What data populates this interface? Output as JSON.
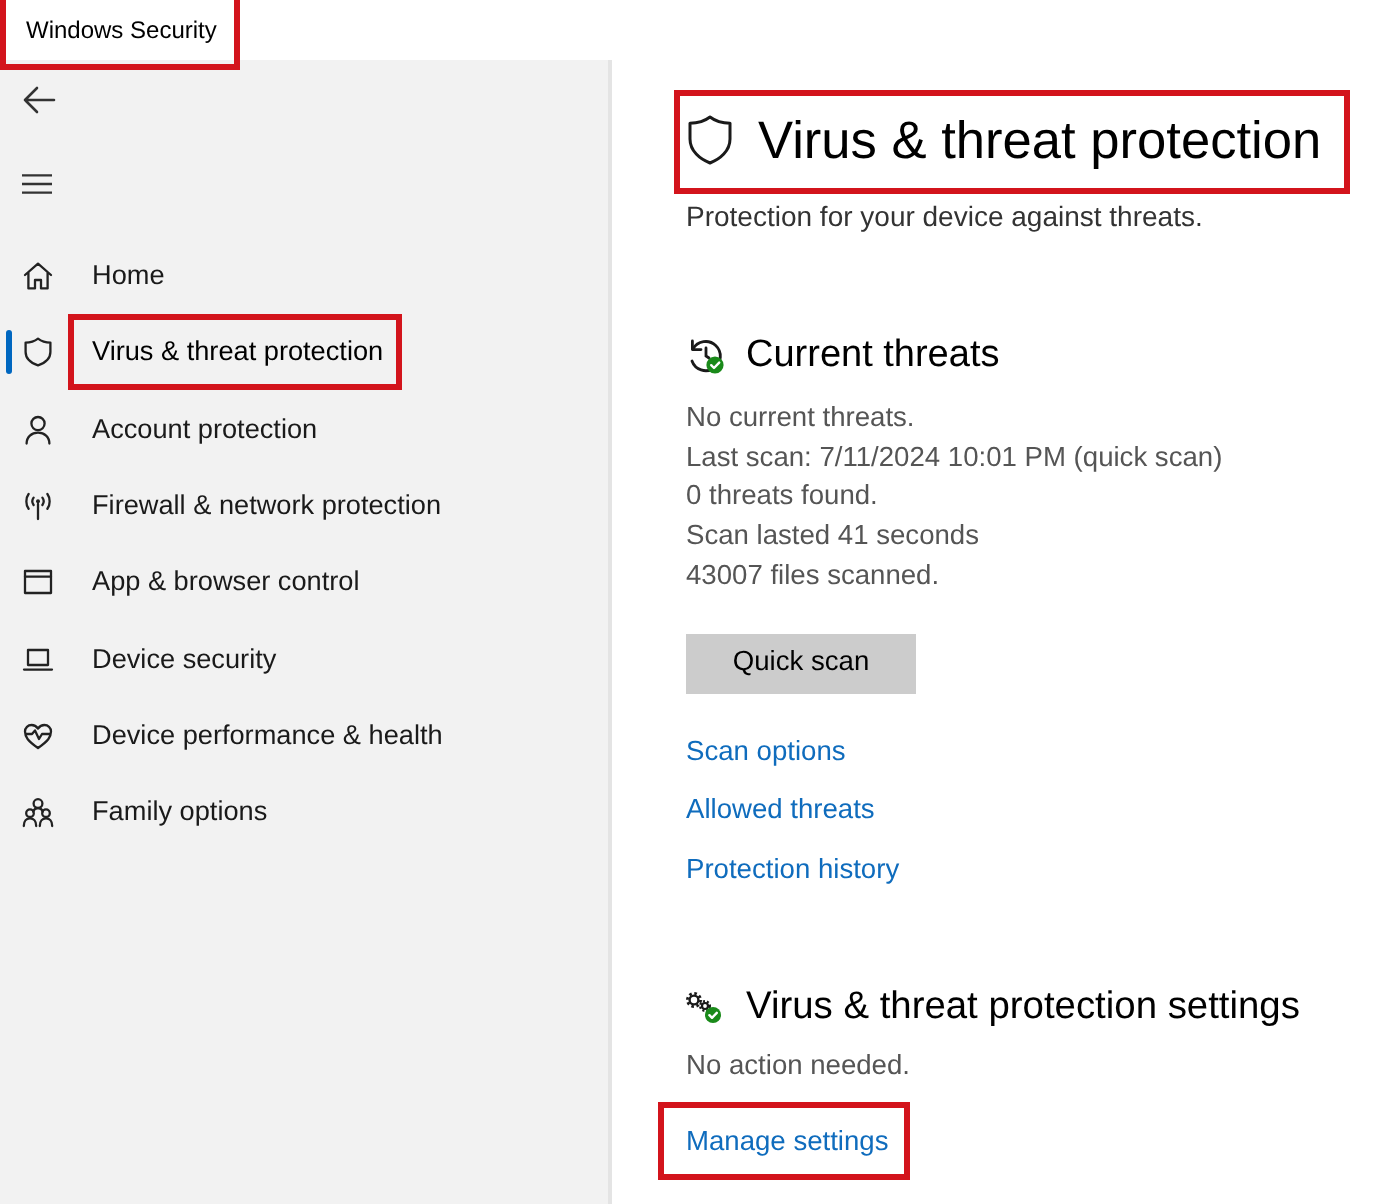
{
  "window": {
    "title": "Windows Security",
    "highlighted": true
  },
  "sidebar": {
    "items": [
      {
        "label": "Home",
        "selected": false,
        "highlighted": false
      },
      {
        "label": "Virus & threat protection",
        "selected": true,
        "highlighted": true
      },
      {
        "label": "Account protection",
        "selected": false,
        "highlighted": false
      },
      {
        "label": "Firewall & network protection",
        "selected": false,
        "highlighted": false
      },
      {
        "label": "App & browser control",
        "selected": false,
        "highlighted": false
      },
      {
        "label": "Device security",
        "selected": false,
        "highlighted": false
      },
      {
        "label": "Device performance & health",
        "selected": false,
        "highlighted": false
      },
      {
        "label": "Family options",
        "selected": false,
        "highlighted": false
      }
    ]
  },
  "page": {
    "title": "Virus & threat protection",
    "highlighted": true,
    "subtitle": "Protection for your device against threats."
  },
  "current_threats": {
    "heading": "Current threats",
    "details": [
      "No current threats.",
      "Last scan: 7/11/2024 10:01 PM (quick scan)",
      "0 threats found.",
      "Scan lasted 41 seconds",
      "43007 files scanned."
    ],
    "button": "Quick scan",
    "links": [
      {
        "label": "Scan options",
        "highlighted": false
      },
      {
        "label": "Allowed threats",
        "highlighted": false
      },
      {
        "label": "Protection history",
        "highlighted": false
      }
    ]
  },
  "settings": {
    "heading": "Virus & threat protection settings",
    "status": "No action needed.",
    "links": [
      {
        "label": "Manage settings",
        "highlighted": true
      }
    ]
  }
}
